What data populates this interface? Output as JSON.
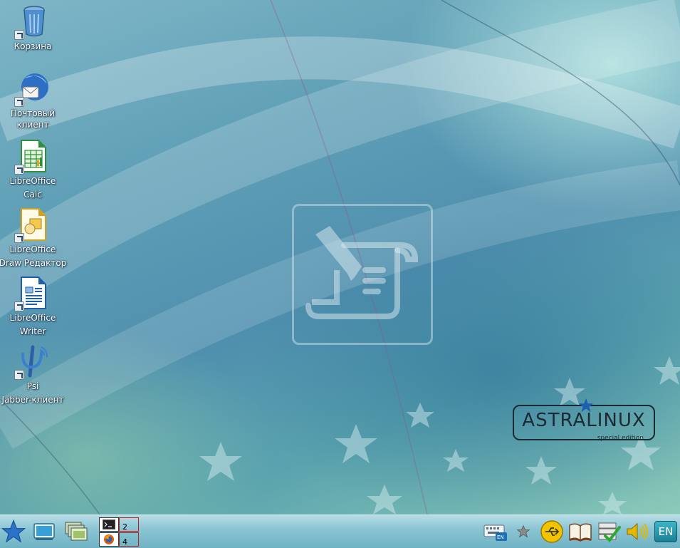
{
  "desktop": {
    "icons": [
      {
        "label_line1": "Корзина",
        "label_line2": "",
        "icon": "trash-icon"
      },
      {
        "label_line1": "Почтовый",
        "label_line2": "клиент",
        "icon": "mail-client-icon"
      },
      {
        "label_line1": "LibreOffice",
        "label_line2": "Calc",
        "icon": "libreoffice-calc-icon"
      },
      {
        "label_line1": "LibreOffice",
        "label_line2": "Draw Редактор",
        "icon": "libreoffice-draw-icon"
      },
      {
        "label_line1": "LibreOffice",
        "label_line2": "Writer",
        "icon": "libreoffice-writer-icon"
      },
      {
        "label_line1": "Psi",
        "label_line2": "Jabber-клиент",
        "icon": "psi-jabber-icon"
      }
    ],
    "wallpaper_logo": {
      "name": "ASTRALINUX",
      "edition": "special edition"
    },
    "watermark_icon": "document-signing-icon"
  },
  "taskbar": {
    "start_icon": "start-menu-star-icon",
    "launchers": [
      "show-desktop-icon",
      "window-switcher-icon"
    ],
    "pager": {
      "desktops": [
        {
          "number": "2",
          "window_icon": "terminal-icon",
          "active": false
        },
        {
          "number": "4",
          "window_icon": "firefox-icon",
          "active": false
        }
      ]
    },
    "tray": {
      "keyboard_layout_indicator": "EN",
      "icons": [
        "favorites-star-icon",
        "usb-icon",
        "manual-book-icon",
        "tasks-check-icon",
        "volume-icon"
      ],
      "language": "EN"
    }
  },
  "colors": {
    "taskbar_top": "#b7dde6",
    "taskbar_bottom": "#6fb2c4",
    "pager_active_border": "#c21b1b"
  }
}
